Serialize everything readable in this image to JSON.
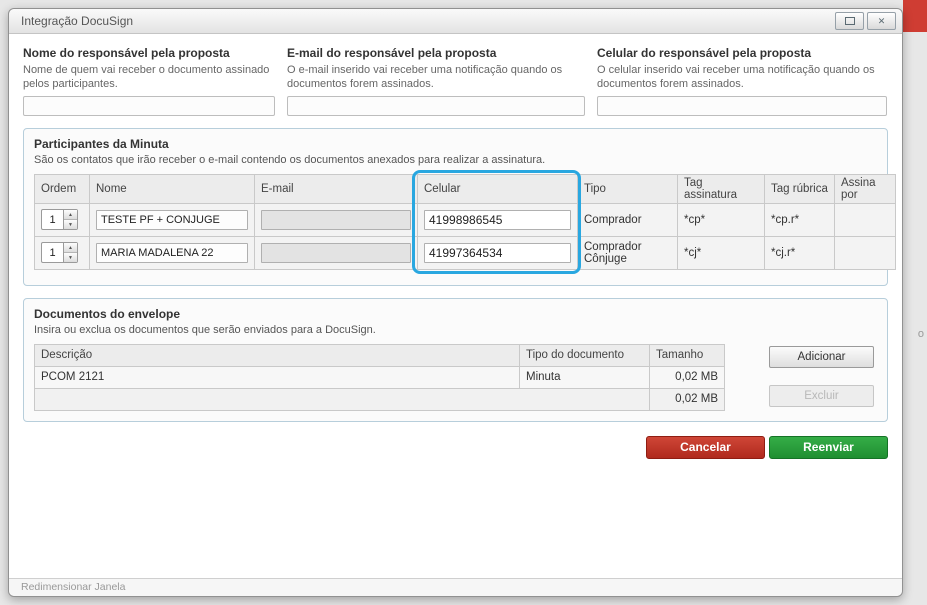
{
  "window": {
    "title": "Integração DocuSign"
  },
  "background": {
    "peek_text": "o"
  },
  "icons": {
    "close": "✕",
    "spinner_up": "▲",
    "spinner_down": "▼"
  },
  "colors": {
    "cancel_red": "#c13b2e",
    "resend_green": "#2aa33c",
    "highlight_blue": "#29a7e0"
  },
  "header_fields": [
    {
      "label": "Nome do responsável pela proposta",
      "description": "Nome de quem vai receber o documento assinado pelos participantes.",
      "value": ""
    },
    {
      "label": "E-mail do responsável pela proposta",
      "description": "O e-mail inserido vai receber uma notificação quando os documentos forem assinados.",
      "value": ""
    },
    {
      "label": "Celular do responsável pela proposta",
      "description": "O celular inserido vai receber uma notificação quando os documentos forem assinados.",
      "value": ""
    }
  ],
  "participants": {
    "title": "Participantes da Minuta",
    "description": "São os contatos que irão receber o e-mail contendo os documentos anexados para realizar a assinatura.",
    "columns": [
      "Ordem",
      "Nome",
      "E-mail",
      "Celular",
      "Tipo",
      "Tag assinatura",
      "Tag rúbrica",
      "Assina por"
    ],
    "rows": [
      {
        "ordem": "1",
        "nome": "TESTE PF + CONJUGE",
        "email": "",
        "celular": "41998986545",
        "tipo": "Comprador",
        "tag_assinatura": "*cp*",
        "tag_rubrica": "*cp.r*",
        "assina_por": ""
      },
      {
        "ordem": "1",
        "nome": "MARIA MADALENA 22",
        "email": "",
        "celular": "41997364534",
        "tipo": "Comprador Cônjuge",
        "tag_assinatura": "*cj*",
        "tag_rubrica": "*cj.r*",
        "assina_por": ""
      }
    ]
  },
  "documents": {
    "title": "Documentos do envelope",
    "description": "Insira ou exclua os documentos que serão enviados para a DocuSign.",
    "columns": [
      "Descrição",
      "Tipo do documento",
      "Tamanho"
    ],
    "rows": [
      {
        "descricao": "PCOM 2121",
        "tipo": "Minuta",
        "tamanho": "0,02 MB"
      }
    ],
    "total": "0,02 MB",
    "add_label": "Adicionar",
    "delete_label": "Excluir"
  },
  "actions": {
    "cancel_label": "Cancelar",
    "resend_label": "Reenviar"
  },
  "footer": {
    "resize_label": "Redimensionar Janela"
  }
}
